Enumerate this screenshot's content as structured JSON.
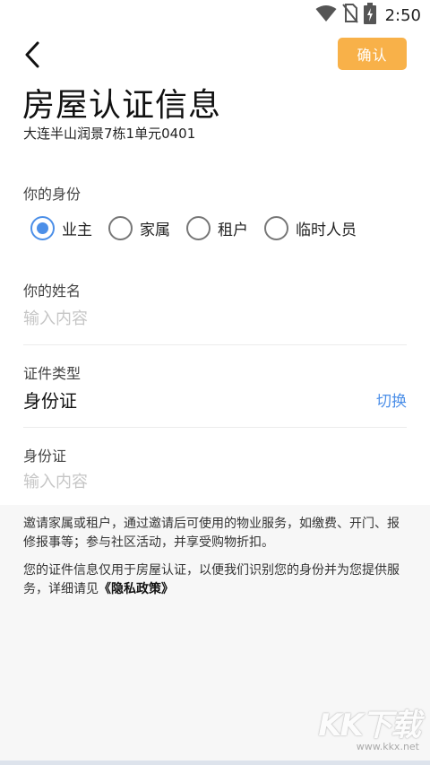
{
  "status_bar": {
    "time": "2:50",
    "icons": [
      "wifi-icon",
      "no-sim-icon",
      "battery-charging-icon"
    ]
  },
  "header": {
    "back_icon": "back-arrow-icon",
    "confirm_label": "确认",
    "title": "房屋认证信息",
    "address": "大连半山润景7栋1单元0401"
  },
  "identity": {
    "label": "你的身份",
    "options": [
      "业主",
      "家属",
      "租户",
      "临时人员"
    ],
    "selected": "业主"
  },
  "name": {
    "label": "你的姓名",
    "placeholder": "输入内容"
  },
  "id_type": {
    "label": "证件类型",
    "value": "身份证",
    "switch_label": "切换"
  },
  "id_number": {
    "label": "身份证",
    "placeholder": "输入内容"
  },
  "notes": {
    "invite_text": "邀请家属或租户，通过邀请后可使用的物业服务，如缴费、开门、报修报事等；参与社区活动，并享受购物折扣。",
    "privacy_prefix": "您的证件信息仅用于房屋认证，以便我们识别您的身份并为您提供服务，详细请见",
    "privacy_link": "《隐私政策》"
  },
  "watermark": {
    "logo": "KK下载",
    "url": "www.kkx.net"
  },
  "colors": {
    "accent_blue": "#4C8FE8",
    "confirm_orange": "#F8B149",
    "panel_gray": "#f7f7f7"
  }
}
